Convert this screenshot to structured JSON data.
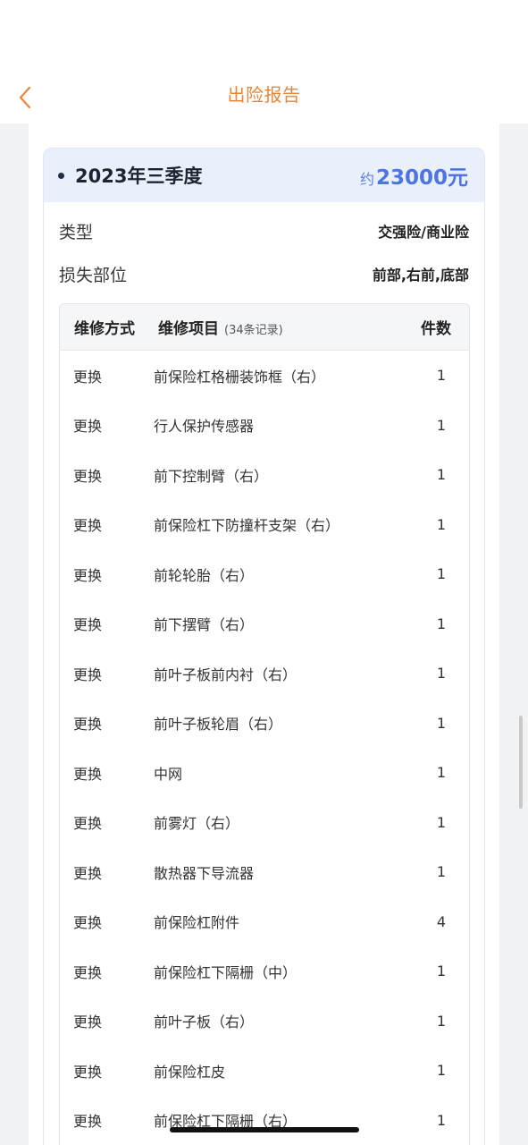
{
  "header": {
    "title": "出险报告",
    "back_icon": "chevron-left-icon"
  },
  "colors": {
    "accent": "#e8873a",
    "amount": "#4d74e6",
    "panel_head": "#eaf0fb"
  },
  "report": {
    "quarter": "2023年三季度",
    "amount_prefix": "约",
    "amount": "23000元",
    "type_label": "类型",
    "type_value": "交强险/商业险",
    "parts_label": "损失部位",
    "parts_value": "前部,右前,底部"
  },
  "table": {
    "headers": {
      "method": "维修方式",
      "item": "维修项目",
      "record_count": "(34条记录)",
      "qty": "件数"
    },
    "rows": [
      {
        "method": "更换",
        "item": "前保险杠格栅装饰框（右）",
        "qty": "1"
      },
      {
        "method": "更换",
        "item": "行人保护传感器",
        "qty": "1"
      },
      {
        "method": "更换",
        "item": "前下控制臂（右）",
        "qty": "1"
      },
      {
        "method": "更换",
        "item": "前保险杠下防撞杆支架（右）",
        "qty": "1"
      },
      {
        "method": "更换",
        "item": "前轮轮胎（右）",
        "qty": "1"
      },
      {
        "method": "更换",
        "item": "前下摆臂（右）",
        "qty": "1"
      },
      {
        "method": "更换",
        "item": "前叶子板前内衬（右）",
        "qty": "1"
      },
      {
        "method": "更换",
        "item": "前叶子板轮眉（右）",
        "qty": "1"
      },
      {
        "method": "更换",
        "item": "中网",
        "qty": "1"
      },
      {
        "method": "更换",
        "item": "前雾灯（右）",
        "qty": "1"
      },
      {
        "method": "更换",
        "item": "散热器下导流器",
        "qty": "1"
      },
      {
        "method": "更换",
        "item": "前保险杠附件",
        "qty": "4"
      },
      {
        "method": "更换",
        "item": "前保险杠下隔栅（中）",
        "qty": "1"
      },
      {
        "method": "更换",
        "item": "前叶子板（右）",
        "qty": "1"
      },
      {
        "method": "更换",
        "item": "前保险杠皮",
        "qty": "1"
      },
      {
        "method": "更换",
        "item": "前保险杠下隔栅（右）",
        "qty": "1"
      }
    ]
  }
}
